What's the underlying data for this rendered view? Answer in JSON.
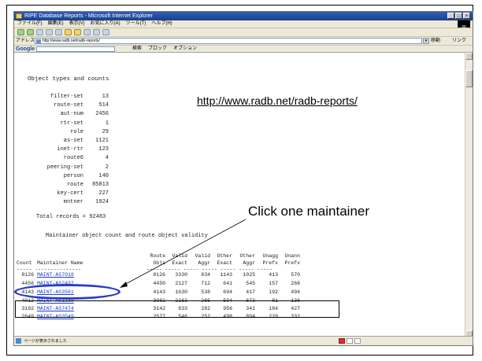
{
  "window": {
    "title": "RIPE Database Reports - Microsoft Internet Explorer",
    "controls": [
      "_",
      "□",
      "×"
    ]
  },
  "menubar": {
    "items": [
      "ファイル(F)",
      "編集(E)",
      "表示(V)",
      "お気に入り(A)",
      "ツール(T)",
      "ヘルプ(H)"
    ]
  },
  "address": {
    "label": "アドレス(D)",
    "value": "http://www.radb.net/radb-reports/",
    "go_label": "移動",
    "links_label": "リンク"
  },
  "googlebar": {
    "logo": "Google",
    "items": [
      "検索",
      "ブロック",
      "オプション"
    ]
  },
  "content": {
    "heading": "Object types and counts",
    "counts": [
      {
        "label": "filter-set",
        "value": "13"
      },
      {
        "label": "route-set",
        "value": "514"
      },
      {
        "label": "aut-num",
        "value": "2456"
      },
      {
        "label": "rtr-set",
        "value": "1"
      },
      {
        "label": "role",
        "value": "29"
      },
      {
        "label": "as-set",
        "value": "1121"
      },
      {
        "label": "inet-rtr",
        "value": "123"
      },
      {
        "label": "route6",
        "value": "4"
      },
      {
        "label": "peering-set",
        "value": "2"
      },
      {
        "label": "person",
        "value": "140"
      },
      {
        "label": "route",
        "value": "85813"
      },
      {
        "label": "key-cert",
        "value": "227"
      },
      {
        "label": "mntner",
        "value": "1924"
      }
    ],
    "total": "Total records = 92483",
    "section2": "Maintainer object count and route object validity",
    "table_headers": {
      "count": "Count",
      "name": "Maintainer Name",
      "cols": [
        [
          "Route",
          "Objs"
        ],
        [
          "Valid",
          "Exact"
        ],
        [
          "Valid",
          "Aggr"
        ],
        [
          "Other",
          "Exact"
        ],
        [
          "Other",
          "Aggr"
        ],
        [
          "Unagg",
          "Prefx"
        ],
        [
          "Unann",
          "Prefx"
        ]
      ]
    },
    "table_rows": [
      {
        "count": "8126",
        "name": "MAINT-AS7018",
        "vals": [
          "8126",
          "3330",
          "834",
          "1143",
          "1025",
          "413",
          "570"
        ]
      },
      {
        "count": "4456",
        "name": "MAINT-AS2497",
        "vals": [
          "4450",
          "2127",
          "712",
          "641",
          "545",
          "157",
          "268"
        ]
      },
      {
        "count": "4143",
        "name": "MAINT-AS3561",
        "vals": [
          "4143",
          "1630",
          "538",
          "694",
          "417",
          "192",
          "494"
        ]
      },
      {
        "count": "4012",
        "name": "MAINT-AS1239",
        "vals": [
          "3982",
          "2163",
          "285",
          "504",
          "673",
          "81",
          "136"
        ]
      },
      {
        "count": "3192",
        "name": "MAINT-AS7474",
        "vals": [
          "3142",
          "833",
          "282",
          "956",
          "341",
          "184",
          "427"
        ]
      },
      {
        "count": "2649",
        "name": "MAINT-AS3549",
        "vals": [
          "2577",
          "546",
          "252",
          "498",
          "894",
          "229",
          "332"
        ]
      }
    ]
  },
  "annotations": {
    "url": "http://www.radb.net/radb-reports/",
    "callout": "Click one maintainer"
  },
  "status": {
    "text": "ページが表示されました"
  },
  "colors": {
    "ellipse": "#2a3ec8",
    "link": "#1a3fd0",
    "titlebar": "#1b3e8f"
  }
}
